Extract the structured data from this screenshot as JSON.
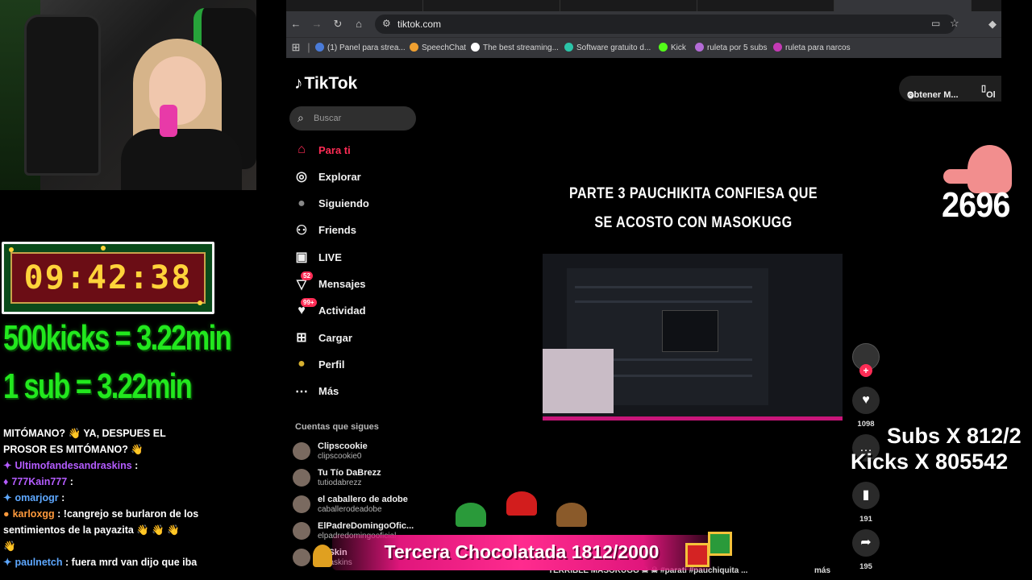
{
  "overlay": {
    "timer": "09:42:38",
    "rate_kicks": "500kicks = 3.22min",
    "rate_sub": "1 sub = 3.22min",
    "counter": "2696",
    "subs_line": "Subs X 812/2",
    "kicks_line": "Kicks X 805542",
    "banner": "Tercera Chocolatada 1812/2000"
  },
  "chat": [
    {
      "user": "",
      "text": "MITÓMANO? 👋 YA, DESPUES EL",
      "color": "#ffffff"
    },
    {
      "user": "",
      "text": "PROSOR ES MITÓMANO? 👋",
      "color": "#ffffff"
    },
    {
      "user": "Ultimofandesandraskins",
      "text": ":",
      "color": "#b45cff",
      "icon": "✦"
    },
    {
      "user": "777Kain777",
      "text": ":",
      "color": "#b45cff",
      "icon": "♦"
    },
    {
      "user": "omarjogr",
      "text": ":",
      "color": "#5ea8ff",
      "icon": "✦"
    },
    {
      "user": "karloxgg",
      "text": ": !cangrejo se burlaron de los",
      "color": "#ff9a3c",
      "icon": "●"
    },
    {
      "user": "",
      "text": "sentimientos de la payazita 👋 👋 👋",
      "color": "#ffffff"
    },
    {
      "user": "",
      "text": "👋",
      "color": "#ffffff"
    },
    {
      "user": "paulnetch",
      "text": ": fuera mrd van dijo que iba",
      "color": "#5ea8ff",
      "icon": "✦"
    }
  ],
  "browser": {
    "url": "tiktok.com",
    "bookmarks": [
      {
        "label": "(1) Panel para strea...",
        "color": "#4a7bd8"
      },
      {
        "label": "SpeechChat",
        "color": "#f0a030"
      },
      {
        "label": "The best streaming...",
        "color": "#ffffff"
      },
      {
        "label": "Software gratuito d...",
        "color": "#2bc4a8"
      },
      {
        "label": "Kick",
        "color": "#53fc18"
      },
      {
        "label": "ruleta por 5 subs",
        "color": "#b36bd6"
      },
      {
        "label": "ruleta para narcos",
        "color": "#c43ab5"
      }
    ]
  },
  "tiktok": {
    "logo": "TikTok",
    "search_placeholder": "Buscar",
    "top_button": "Obtener M...",
    "top_button2": "Ol",
    "nav": [
      {
        "label": "Para ti",
        "icon": "home-icon",
        "active": true
      },
      {
        "label": "Explorar",
        "icon": "compass-icon"
      },
      {
        "label": "Siguiendo",
        "icon": "following-icon"
      },
      {
        "label": "Friends",
        "icon": "friends-icon"
      },
      {
        "label": "LIVE",
        "icon": "live-icon"
      },
      {
        "label": "Mensajes",
        "icon": "messages-icon",
        "badge": "52"
      },
      {
        "label": "Actividad",
        "icon": "activity-icon",
        "badge": "99+"
      },
      {
        "label": "Cargar",
        "icon": "upload-icon"
      },
      {
        "label": "Perfil",
        "icon": "profile-icon"
      },
      {
        "label": "Más",
        "icon": "more-icon"
      }
    ],
    "following_title": "Cuentas que sigues",
    "accounts": [
      {
        "name": "Clipscookie",
        "handle": "clipscookie0"
      },
      {
        "name": "Tu Tío DaBrezz",
        "handle": "tutiodabrezz"
      },
      {
        "name": "el caballero de adobe",
        "handle": "caballerodeadobe"
      },
      {
        "name": "ElPadreDomingoOfic...",
        "handle": "elpadredomingooficial"
      },
      {
        "name": "ra Skin",
        "handle": "ndraskins"
      }
    ],
    "video": {
      "caption_line1": "PARTE 3 PAUCHIKITA CONFIESA QUE",
      "caption_line2": "SE ACOSTO CON MASOKUGG",
      "likes": "1098",
      "bookmarks": "191",
      "shares": "195",
      "bottom_caption": "TERRIBLE MASOKUGG ☠ ☠ #parati #pauchiquita ...",
      "more": "más"
    }
  }
}
